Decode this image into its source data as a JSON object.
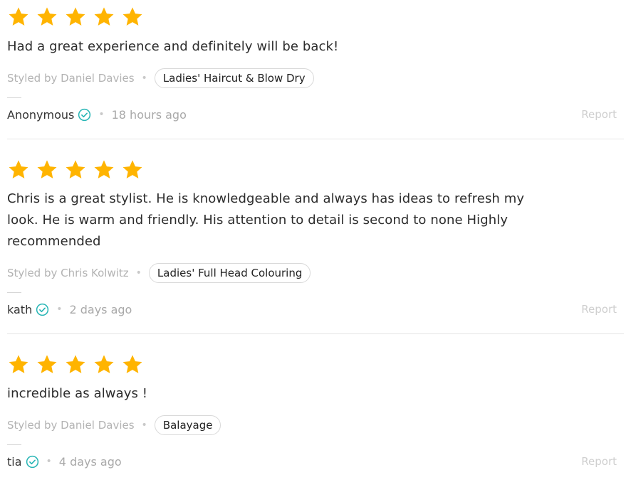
{
  "colors": {
    "star": "#FFB400",
    "verified": "#27B5B5",
    "muted_text": "#B3B3B3",
    "report_text": "#CFCFCF"
  },
  "icons": {
    "star": "star-icon",
    "verified": "verified-check-icon"
  },
  "reviews": [
    {
      "rating": 5,
      "text": "Had a great experience and definitely will be back!",
      "styled_by": "Styled by Daniel Davies",
      "service": "Ladies' Haircut & Blow Dry",
      "author": "Anonymous",
      "time": "18 hours ago",
      "report_label": "Report"
    },
    {
      "rating": 5,
      "text": "Chris is a great stylist. He is knowledgeable and always has ideas to refresh my look. He is warm and friendly. His attention to detail is second to none Highly recommended",
      "styled_by": "Styled by Chris Kolwitz",
      "service": "Ladies' Full Head Colouring",
      "author": "kath",
      "time": "2 days ago",
      "report_label": "Report"
    },
    {
      "rating": 5,
      "text": "incredible as always !",
      "styled_by": "Styled by Daniel Davies",
      "service": "Balayage",
      "author": "tia",
      "time": "4 days ago",
      "report_label": "Report"
    }
  ]
}
